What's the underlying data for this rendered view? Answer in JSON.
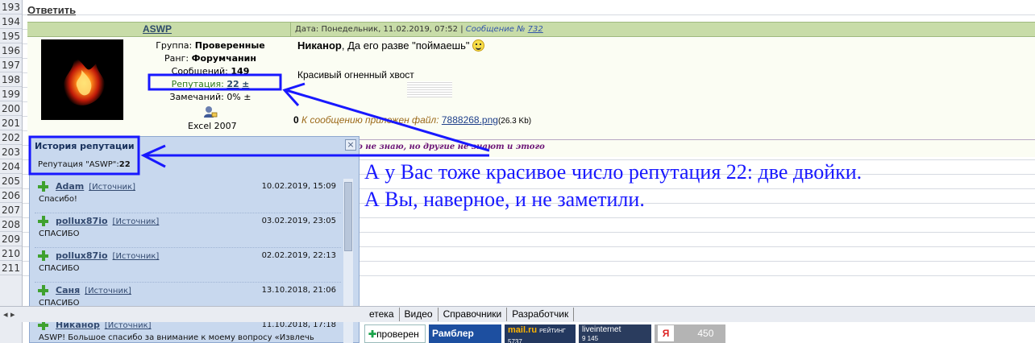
{
  "sheet": {
    "rows": [
      "193",
      "194",
      "195",
      "196",
      "197",
      "198",
      "199",
      "200",
      "201",
      "202",
      "203",
      "204",
      "205",
      "206",
      "207",
      "208",
      "209",
      "210",
      "211"
    ],
    "reply_link": "Ответить",
    "tabs": [
      "етека",
      "Видео",
      "Справочники",
      "Разработчик"
    ]
  },
  "post": {
    "author": "ASWP",
    "date_label": "Дата: Понедельник, 11.02.2019, 07:52",
    "separator": "|",
    "message_label": "Сообщение №",
    "message_number": "732",
    "user": {
      "group_label": "Группа:",
      "group_value": "Проверенные",
      "rank_label": "Ранг:",
      "rank_value": "Форумчанин",
      "posts_label": "Сообщений:",
      "posts_value": "149",
      "reputation_label": "Репутация:",
      "reputation_value": "22",
      "reputation_pm": "±",
      "warnings_label": "Замечаний:",
      "warnings_value": "0%",
      "warnings_pm": "±",
      "signature": "Excel 2007"
    },
    "body": {
      "addressee": "Никанор",
      "text1": ", Да его разве \"поймаешь\"",
      "text2": "Красивый огненный хвост",
      "attachment_label": "К сообщению приложен файл:",
      "attachment_file": "7888268.png",
      "attachment_size": "(26.3 Kb)",
      "clip": "0",
      "footer_quote": "чего не знаю, но другие не знают и этого"
    }
  },
  "annotation": {
    "line1": "А у Вас тоже красивое число репутация 22: две двойки.",
    "line2": "А Вы, наверное, и не заметили.",
    "arrow_color": "#1818ff"
  },
  "reputation_popup": {
    "title": "История репутации",
    "close": "×",
    "summary_label": "Репутация \"ASWP\":",
    "summary_value": "22",
    "source_label": "[Источник]",
    "items": [
      {
        "user": "Adam",
        "date": "10.02.2019, 15:09",
        "comment": "Спасибо!"
      },
      {
        "user": "pollux87io",
        "date": "03.02.2019, 23:05",
        "comment": "СПАСИБО"
      },
      {
        "user": "pollux87io",
        "date": "02.02.2019, 22:13",
        "comment": "СПАСИБО"
      },
      {
        "user": "Саня",
        "date": "13.10.2018, 21:06",
        "comment": "СПАСИБО"
      },
      {
        "user": "Никанор",
        "date": "11.10.2018, 17:18",
        "comment": "ASWP! Большое спасибо за внимание к моему вопросу «Извлечь число"
      }
    ]
  },
  "counters": {
    "verified": "проверен",
    "rambler": "Рамблер",
    "mailru": "mail.ru",
    "mailru_sub": "РЕЙТИНГ",
    "mailru_num": "5737",
    "liveinternet": "liveinternet",
    "liveinternet_num": "9 145",
    "yandex": "Я",
    "yandex_num": "450"
  }
}
